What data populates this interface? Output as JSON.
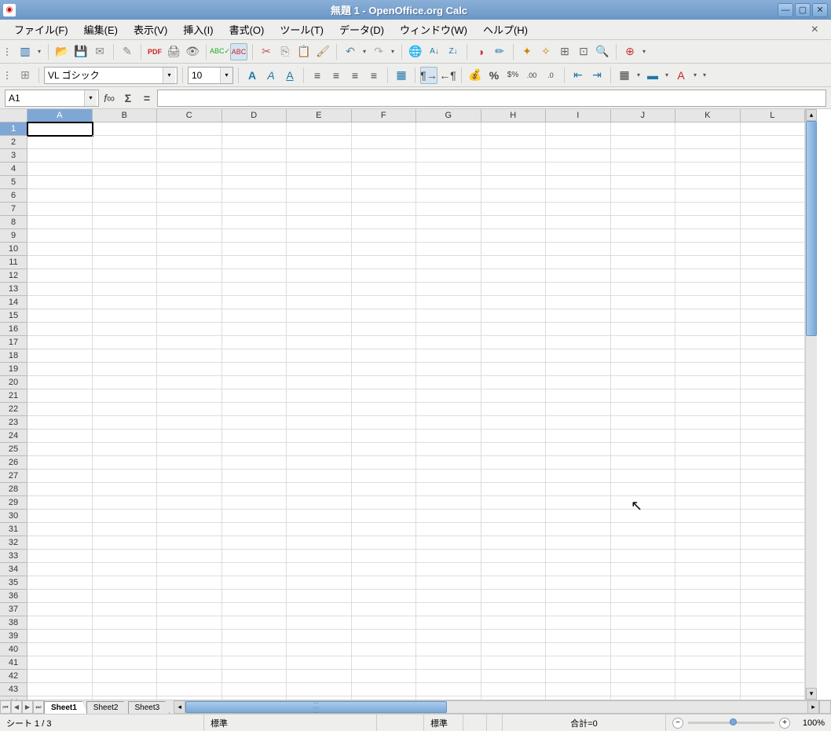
{
  "window": {
    "title": "無題 1  -  OpenOffice.org Calc"
  },
  "menu": {
    "file": "ファイル(F)",
    "edit": "編集(E)",
    "view": "表示(V)",
    "insert": "挿入(I)",
    "format": "書式(O)",
    "tools": "ツール(T)",
    "data": "データ(D)",
    "window": "ウィンドウ(W)",
    "help": "ヘルプ(H)"
  },
  "font": {
    "name": "VL ゴシック",
    "size": "10"
  },
  "formula": {
    "cellref": "A1",
    "value": ""
  },
  "columns": [
    "A",
    "B",
    "C",
    "D",
    "E",
    "F",
    "G",
    "H",
    "I",
    "J",
    "K",
    "L"
  ],
  "row_count": 45,
  "active_cell": {
    "col": "A",
    "row": 1
  },
  "tabs": {
    "items": [
      "Sheet1",
      "Sheet2",
      "Sheet3"
    ],
    "active": 0
  },
  "status": {
    "sheet": "シート 1 / 3",
    "pagestyle": "標準",
    "insertmode": "標準",
    "sum": "合計=0",
    "zoom": "100%"
  }
}
